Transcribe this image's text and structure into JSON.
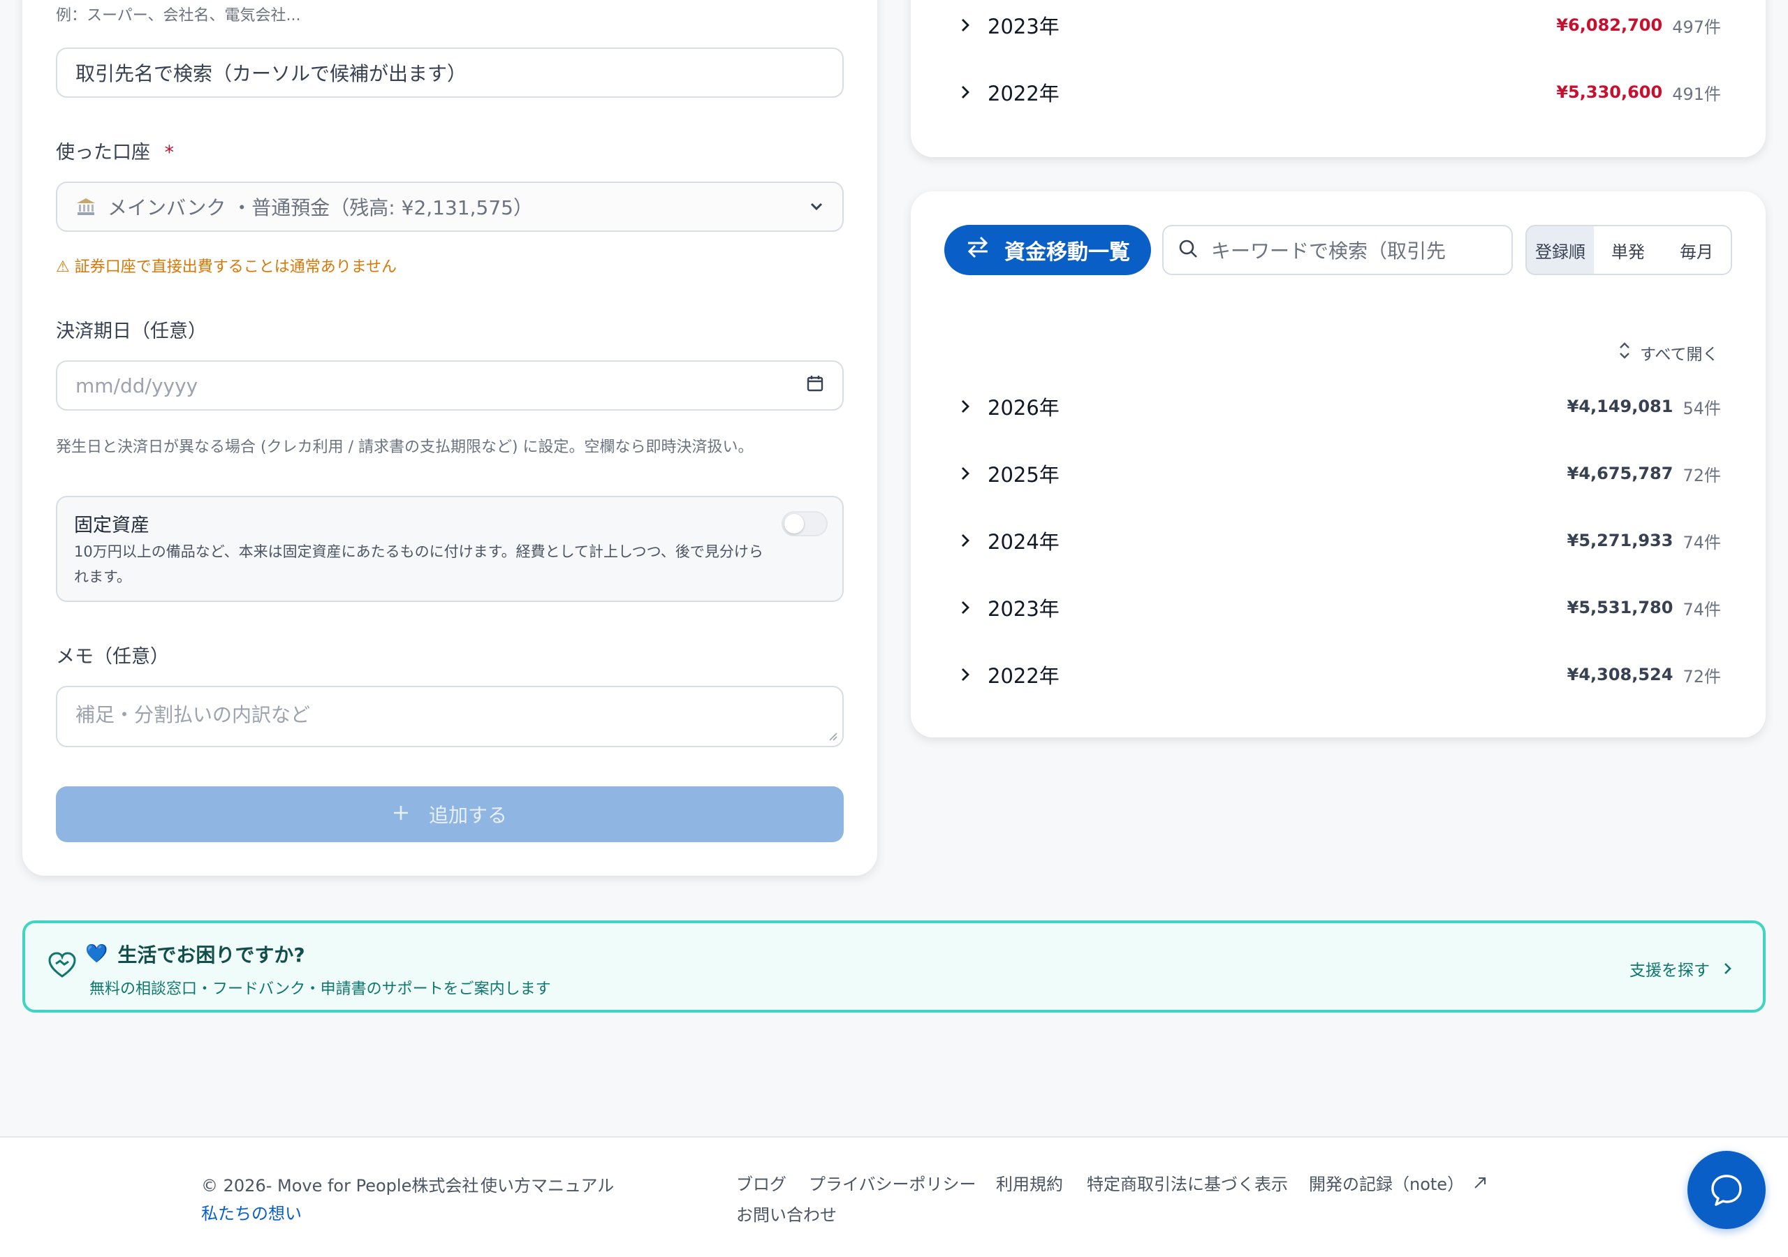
{
  "form": {
    "vendor_hint": "例：スーパー、会社名、電気会社...",
    "vendor_placeholder": "取引先名で検索（カーソルで候補が出ます）",
    "account_label": "使った口座",
    "required_mark": "*",
    "account_icon": "bank-icon",
    "account_value": "メインバンク ・普通預金（残高: ¥2,131,575）",
    "account_warning": "⚠ 証券口座で直接出費することは通常ありません",
    "settle_label": "決済期日（任意）",
    "settle_placeholder": "mm/dd/yyyy",
    "settle_hint": "発生日と決済日が異なる場合 (クレカ利用 / 請求書の支払期限など) に設定。空欄なら即時決済扱い。",
    "fixed_asset_title": "固定資産",
    "fixed_asset_desc": "10万円以上の備品など、本来は固定資産にあたるものに付けます。経費として計上しつつ、後で見分けられます。",
    "fixed_asset_on": false,
    "memo_label": "メモ（任意）",
    "memo_placeholder": "補足・分割払いの内訳など",
    "add_label": "追加する",
    "add_icon": "plus-icon"
  },
  "top_years": [
    {
      "year": "2023年",
      "amount": "¥6,082,700",
      "count": "497件"
    },
    {
      "year": "2022年",
      "amount": "¥5,330,600",
      "count": "491件"
    }
  ],
  "transfer": {
    "title": "資金移動一覧",
    "search_placeholder": "キーワードで検索（取引先",
    "sort_options": [
      "登録順",
      "単発",
      "毎月"
    ],
    "sort_selected": "登録順",
    "expand_all": "すべて開く",
    "years": [
      {
        "year": "2026年",
        "amount": "¥4,149,081",
        "count": "54件"
      },
      {
        "year": "2025年",
        "amount": "¥4,675,787",
        "count": "72件"
      },
      {
        "year": "2024年",
        "amount": "¥5,271,933",
        "count": "74件"
      },
      {
        "year": "2023年",
        "amount": "¥5,531,780",
        "count": "74件"
      },
      {
        "year": "2022年",
        "amount": "¥4,308,524",
        "count": "72件"
      }
    ]
  },
  "support": {
    "heart": "💙",
    "title": "生活でお困りですか?",
    "subtitle": "無料の相談窓口・フードバンク・申請書のサポートをご案内します",
    "link": "支援を探す"
  },
  "footer": {
    "copyright": "© 2026- Move for People株式会社",
    "manual": "使い方マニュアル",
    "vision": "私たちの想い",
    "links": [
      "ブログ",
      "プライバシーポリシー",
      "利用規約",
      "特定商取引法に基づく表示",
      "開発の記録（note）"
    ],
    "contact": "お問い合わせ"
  },
  "colors": {
    "primary": "#0a5fc6",
    "expense_red": "#c8102e",
    "warning": "#d97706",
    "support_border": "#3fd5c2",
    "support_bg": "#effcf9",
    "support_text": "#0f766e"
  }
}
